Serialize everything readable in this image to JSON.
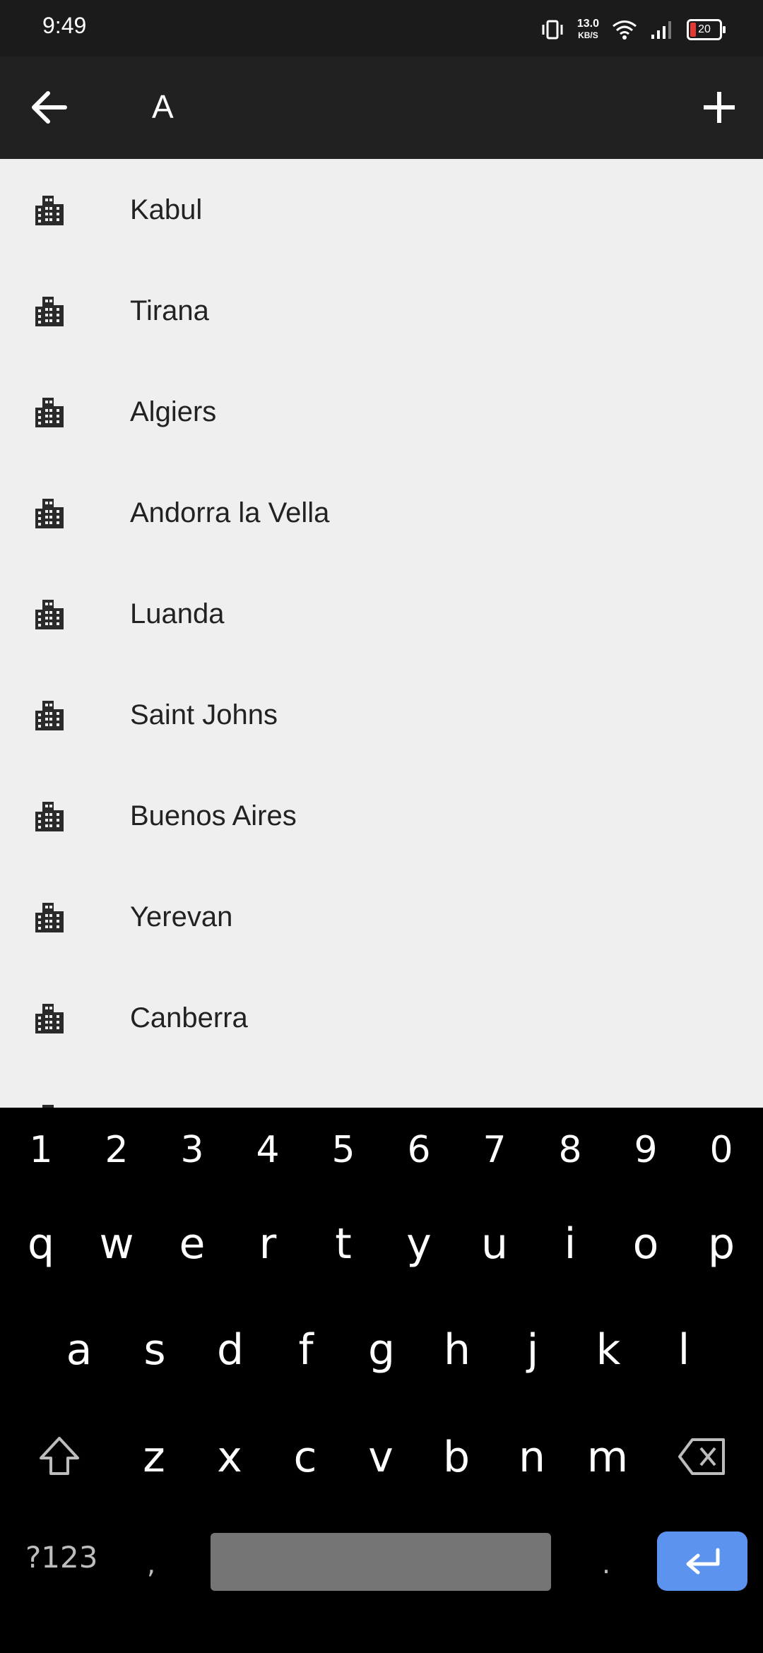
{
  "status_bar": {
    "time": "9:49",
    "net_speed_value": "13.0",
    "net_speed_unit": "KB/S",
    "battery": "20",
    "icons": [
      "vibrate-icon",
      "wifi-icon",
      "signal-icon",
      "battery-icon"
    ]
  },
  "app_bar": {
    "title": "A",
    "back_icon": "arrow-back-icon",
    "add_icon": "plus-icon"
  },
  "cities": [
    {
      "name": "Kabul",
      "icon": "city-icon"
    },
    {
      "name": "Tirana",
      "icon": "city-icon"
    },
    {
      "name": "Algiers",
      "icon": "city-icon"
    },
    {
      "name": "Andorra la Vella",
      "icon": "city-icon"
    },
    {
      "name": "Luanda",
      "icon": "city-icon"
    },
    {
      "name": "Saint Johns",
      "icon": "city-icon"
    },
    {
      "name": "Buenos Aires",
      "icon": "city-icon"
    },
    {
      "name": "Yerevan",
      "icon": "city-icon"
    },
    {
      "name": "Canberra",
      "icon": "city-icon"
    }
  ],
  "keyboard": {
    "numbers": [
      "1",
      "2",
      "3",
      "4",
      "5",
      "6",
      "7",
      "8",
      "9",
      "0"
    ],
    "row1": [
      "q",
      "w",
      "e",
      "r",
      "t",
      "y",
      "u",
      "i",
      "o",
      "p"
    ],
    "row2": [
      "a",
      "s",
      "d",
      "f",
      "g",
      "h",
      "j",
      "k",
      "l"
    ],
    "row3": [
      "z",
      "x",
      "c",
      "v",
      "b",
      "n",
      "m"
    ],
    "symbols_label": "?123",
    "comma": ",",
    "period": ".",
    "enter_color": "#5b93ef"
  },
  "colors": {
    "app_bar": "#212121",
    "background": "#efefef",
    "battery_low": "#e53935"
  }
}
